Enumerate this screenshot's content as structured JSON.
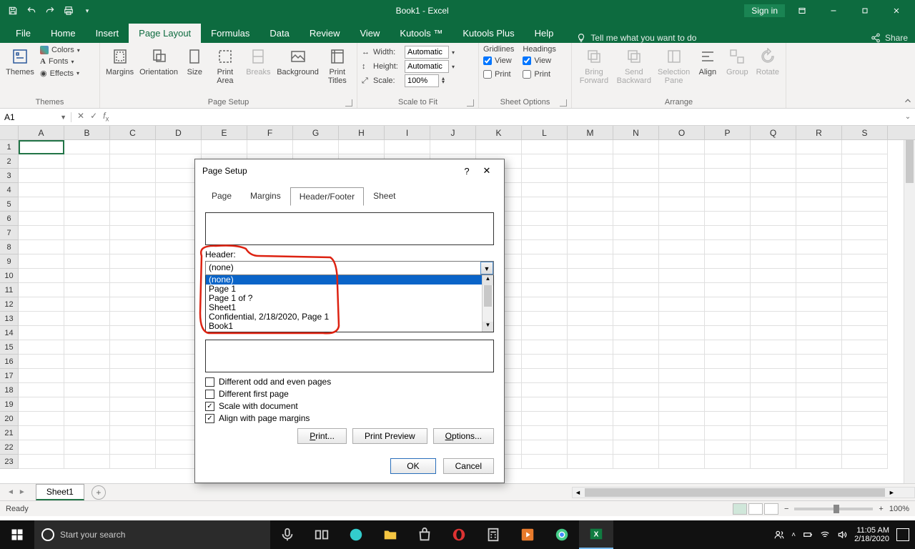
{
  "title": "Book1  -  Excel",
  "signin": "Sign in",
  "tabs": {
    "file": "File",
    "home": "Home",
    "insert": "Insert",
    "pagelayout": "Page Layout",
    "formulas": "Formulas",
    "data": "Data",
    "review": "Review",
    "view": "View",
    "kutools": "Kutools ™",
    "kutoolsplus": "Kutools Plus",
    "help": "Help",
    "tellme": "Tell me what you want to do",
    "share": "Share"
  },
  "ribbon": {
    "themes": {
      "label": "Themes",
      "themes": "Themes",
      "colors": "Colors",
      "fonts": "Fonts",
      "effects": "Effects"
    },
    "pagesetup": {
      "label": "Page Setup",
      "margins": "Margins",
      "orientation": "Orientation",
      "size": "Size",
      "printarea": "Print\nArea",
      "breaks": "Breaks",
      "background": "Background",
      "printtitles": "Print\nTitles"
    },
    "scale": {
      "label": "Scale to Fit",
      "width": "Width:",
      "height": "Height:",
      "scale": "Scale:",
      "auto": "Automatic",
      "pct": "100%"
    },
    "sheetopt": {
      "label": "Sheet Options",
      "gridlines": "Gridlines",
      "headings": "Headings",
      "view": "View",
      "print": "Print"
    },
    "arrange": {
      "label": "Arrange",
      "bringfwd": "Bring\nForward",
      "sendback": "Send\nBackward",
      "selpane": "Selection\nPane",
      "align": "Align",
      "group": "Group",
      "rotate": "Rotate"
    }
  },
  "namebox": "A1",
  "columns": [
    "A",
    "B",
    "C",
    "D",
    "E",
    "F",
    "G",
    "H",
    "I",
    "J",
    "K",
    "L",
    "M",
    "N",
    "O",
    "P",
    "Q",
    "R",
    "S"
  ],
  "rows": [
    1,
    2,
    3,
    4,
    5,
    6,
    7,
    8,
    9,
    10,
    11,
    12,
    13,
    14,
    15,
    16,
    17,
    18,
    19,
    20,
    21,
    22,
    23
  ],
  "sheettab": "Sheet1",
  "status": "Ready",
  "zoom": "100%",
  "dialog": {
    "title": "Page Setup",
    "tabs": {
      "page": "Page",
      "margins": "Margins",
      "hf": "Header/Footer",
      "sheet": "Sheet"
    },
    "header_label": "Header:",
    "header_value": "(none)",
    "options": [
      "(none)",
      "Page 1",
      "Page 1 of ?",
      "Sheet1",
      "Confidential, 2/18/2020, Page 1",
      "Book1"
    ],
    "chk": {
      "oddeven": "Different odd and even pages",
      "firstpage": "Different first page",
      "scale": "Scale with document",
      "align": "Align with page margins"
    },
    "buttons": {
      "print": "Print...",
      "preview": "Print Preview",
      "options": "Options...",
      "ok": "OK",
      "cancel": "Cancel"
    }
  },
  "taskbar": {
    "search": "Start your search",
    "time": "11:05 AM",
    "date": "2/18/2020"
  }
}
